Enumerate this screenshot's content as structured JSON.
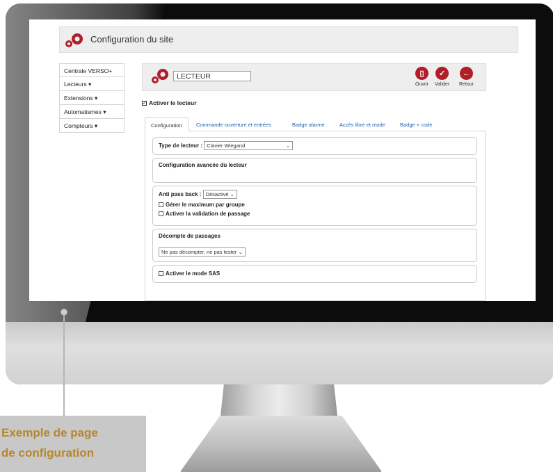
{
  "site_header": {
    "title": "Configuration du site"
  },
  "sidebar": {
    "items": [
      {
        "label": "Centrale VERSO+"
      },
      {
        "label": "Lecteurs ▾"
      },
      {
        "label": "Extensions ▾"
      },
      {
        "label": "Automatismes ▾"
      },
      {
        "label": "Compteurs ▾"
      }
    ]
  },
  "reader": {
    "name_value": "LECTEUR",
    "actions": {
      "open": "Ouvrir",
      "validate": "Valider",
      "back": "Retour"
    },
    "activate_label": "Activer le lecteur"
  },
  "tabs": [
    {
      "label": "Configuration"
    },
    {
      "label": "Commande ouverture et entrées"
    },
    {
      "label": "Badge alarme"
    },
    {
      "label": "Accès libre et mode"
    },
    {
      "label": "Badge + code"
    }
  ],
  "form": {
    "reader_type_label": "Type de lecteur :",
    "reader_type_value": "Clavier Wiegand",
    "advanced_config_label": "Configuration avancée du lecteur",
    "anti_pass_back_label": "Anti pass back :",
    "anti_pass_back_value": "Désactivé",
    "manage_max_group_label": "Gérer le maximum par groupe",
    "activate_validation_label": "Activer la validation de passage",
    "pass_count_label": "Décompte de passages",
    "pass_count_value": "Ne pas décompter, ne pas tester",
    "sas_mode_label": "Activer le mode SAS"
  },
  "caption": {
    "line1": "Exemple de page",
    "line2": "de configuration"
  },
  "colors": {
    "accent": "#b01e2a",
    "link": "#1a5fb4",
    "caption_text": "#b8862a",
    "caption_bg": "#c8c8c8"
  }
}
